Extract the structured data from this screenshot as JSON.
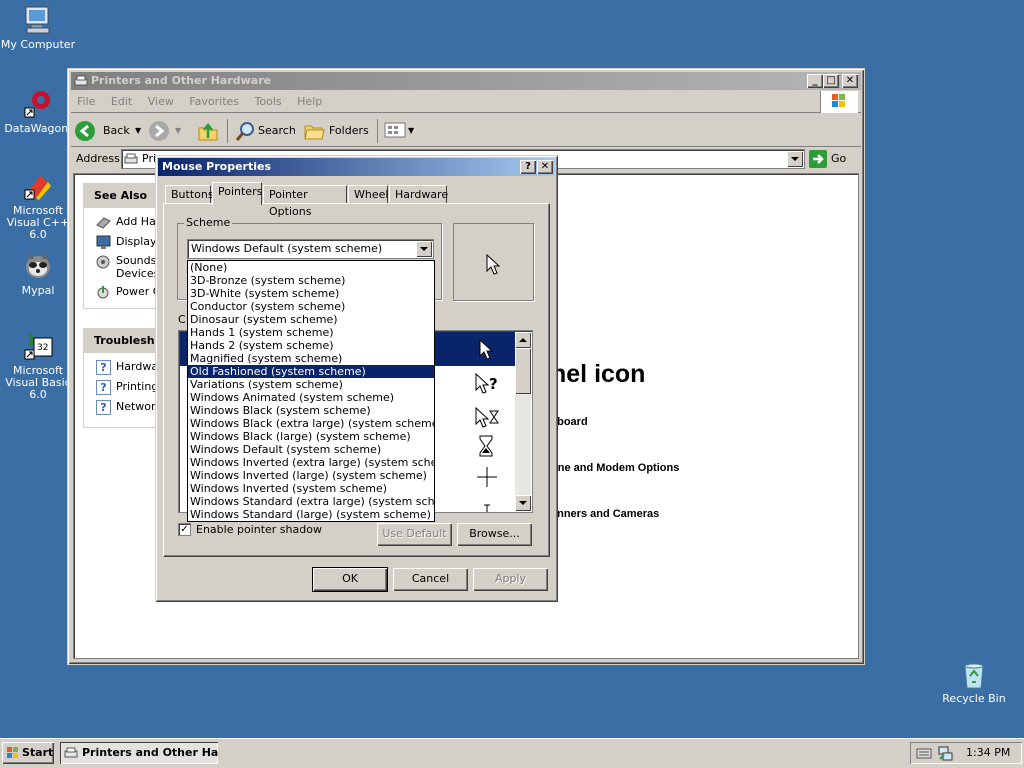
{
  "desktop": {
    "icons": [
      {
        "label": "My Computer",
        "icon": "my-computer-icon"
      },
      {
        "label": "DataWagon.",
        "icon": "datawagon-icon"
      },
      {
        "label": "Microsoft Visual C++ 6.0",
        "icon": "visual-cpp-icon"
      },
      {
        "label": "Mypal",
        "icon": "mypal-icon"
      },
      {
        "label": "Microsoft Visual Basic 6.0",
        "icon": "visual-basic-icon"
      },
      {
        "label": "Recycle Bin",
        "icon": "recycle-bin-icon"
      }
    ],
    "background_color": "#3a6ea5"
  },
  "explorer": {
    "title": "Printers and Other Hardware",
    "menu": [
      "File",
      "Edit",
      "View",
      "Favorites",
      "Tools",
      "Help"
    ],
    "toolbar": {
      "back": "Back",
      "search": "Search",
      "folders": "Folders"
    },
    "address_label": "Address",
    "address_value": "Pri",
    "go_label": "Go",
    "see_also": {
      "title": "See Also",
      "items": [
        "Add Har",
        "Display",
        "Sounds, Devices",
        "Power C"
      ]
    },
    "troubleshoot": {
      "title": "Troublesho",
      "items": [
        "Hardwa",
        "Printing",
        "Network"
      ]
    },
    "heading_partial": "nel icon",
    "categories": [
      "yboard",
      "one and Modem Options",
      "anners and Cameras"
    ]
  },
  "dialog": {
    "title": "Mouse Properties",
    "help_btn": "?",
    "tabs": [
      "Buttons",
      "Pointers",
      "Pointer Options",
      "Wheel",
      "Hardware"
    ],
    "active_tab": "Pointers",
    "scheme_label": "Scheme",
    "scheme_value": "Windows Default (system scheme)",
    "scheme_options": [
      "(None)",
      "3D-Bronze (system scheme)",
      "3D-White (system scheme)",
      "Conductor (system scheme)",
      "Dinosaur (system scheme)",
      "Hands 1 (system scheme)",
      "Hands 2 (system scheme)",
      "Magnified (system scheme)",
      "Old Fashioned (system scheme)",
      "Variations (system scheme)",
      "Windows Animated (system scheme)",
      "Windows Black  (system scheme)",
      "Windows Black (extra large) (system scheme)",
      "Windows Black (large) (system scheme)",
      "Windows Default (system scheme)",
      "Windows Inverted (extra large) (system scheme)",
      "Windows Inverted (large) (system scheme)",
      "Windows Inverted (system scheme)",
      "Windows Standard (extra large) (system scheme)",
      "Windows Standard (large) (system scheme)"
    ],
    "highlighted_option_index": 8,
    "customize_partial": "C",
    "enable_shadow_label": "Enable pointer shadow",
    "enable_shadow_checked": true,
    "use_default_label": "Use Default",
    "browse_label": "Browse...",
    "ok_label": "OK",
    "cancel_label": "Cancel",
    "apply_label": "Apply"
  },
  "taskbar": {
    "start_label": "Start",
    "task_label": "Printers and Other Ha...",
    "clock": "1:34 PM"
  }
}
